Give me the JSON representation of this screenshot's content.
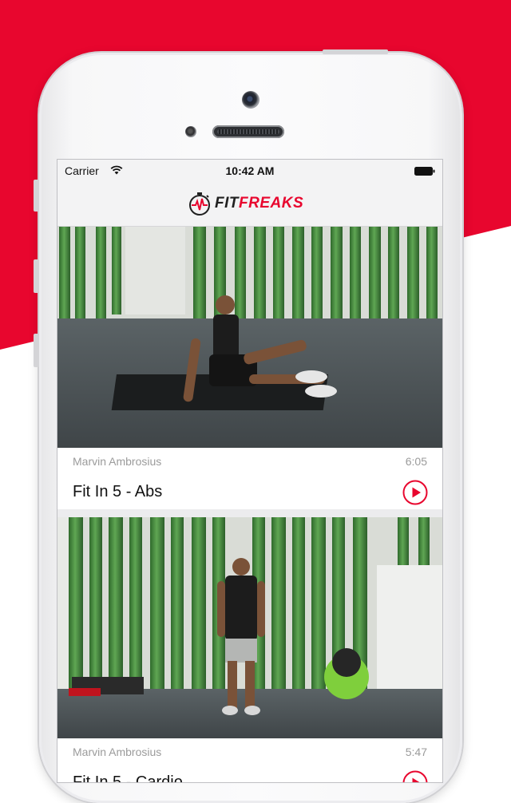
{
  "colors": {
    "accent": "#e8062e",
    "background": "#ffffff"
  },
  "status_bar": {
    "carrier": "Carrier",
    "time": "10:42 AM",
    "wifi_icon": "wifi-icon",
    "battery_icon": "battery-icon"
  },
  "header": {
    "logo_part1": "FIT",
    "logo_part2": "FREAKS"
  },
  "videos": [
    {
      "author": "Marvin Ambrosius",
      "duration": "6:05",
      "title": "Fit In 5 - Abs"
    },
    {
      "author": "Marvin Ambrosius",
      "duration": "5:47",
      "title": "Fit In 5 - Cardio"
    }
  ]
}
